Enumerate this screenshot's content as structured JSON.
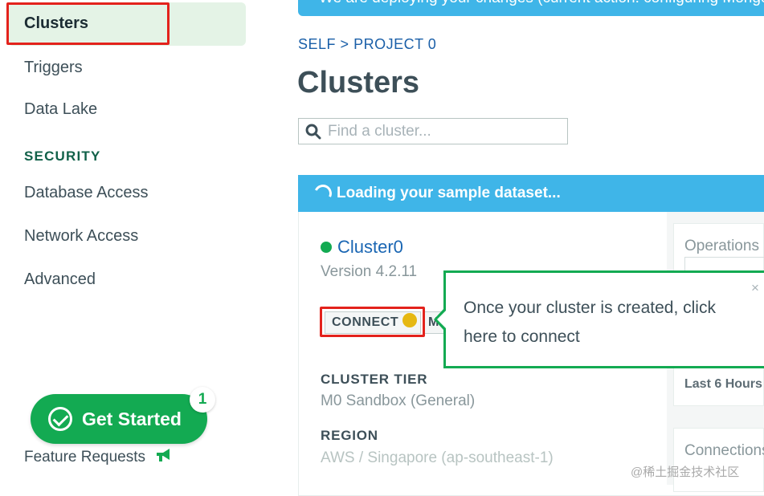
{
  "sidebar": {
    "items": [
      {
        "label": "Clusters"
      },
      {
        "label": "Triggers"
      },
      {
        "label": "Data Lake"
      }
    ],
    "security_title": "SECURITY",
    "security_items": [
      {
        "label": "Database Access"
      },
      {
        "label": "Network Access"
      },
      {
        "label": "Advanced"
      }
    ],
    "get_started": {
      "label": "Get Started",
      "badge": "1"
    },
    "feature_requests": "Feature Requests"
  },
  "banner": {
    "text": "We are deploying your changes (current action: configuring MongoDB)"
  },
  "breadcrumb": {
    "org": "SELF",
    "separator": ">",
    "project": "PROJECT 0"
  },
  "page_title": "Clusters",
  "search": {
    "placeholder": "Find a cluster..."
  },
  "loading": {
    "text": "Loading your sample dataset..."
  },
  "cluster": {
    "name": "Cluster0",
    "status_color": "#13aa52",
    "version": "Version 4.2.11",
    "connect_label": "CONNECT",
    "metrics_label": "METRICS",
    "tier_label": "CLUSTER TIER",
    "tier_value": "M0 Sandbox (General)",
    "region_label": "REGION",
    "region_value": "AWS / Singapore (ap-southeast-1)"
  },
  "tooltip": {
    "text": "Once your cluster is created, click here to connect",
    "close": "×"
  },
  "right_panel": {
    "operations": "Operations",
    "last": "Last 6 Hours",
    "connections": "Connections"
  },
  "watermark": "@稀土掘金技术社区",
  "colors": {
    "accent_green": "#13aa52",
    "banner_blue": "#3fb5e8",
    "link_blue": "#016bf8",
    "highlight_red": "#e3221c"
  }
}
